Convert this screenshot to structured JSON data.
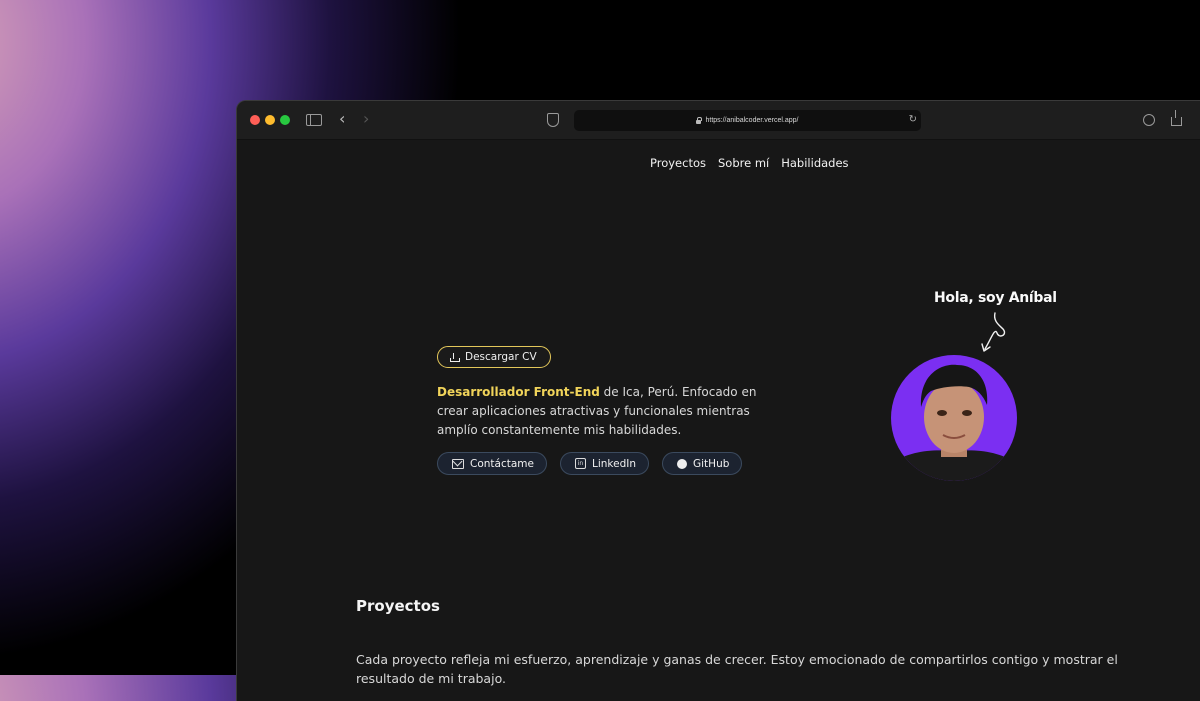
{
  "browser": {
    "url": "https://anibalcoder.vercel.app/"
  },
  "nav": {
    "items": [
      "Proyectos",
      "Sobre mí",
      "Habilidades"
    ]
  },
  "hero": {
    "cv_button": "Descargar CV",
    "role_highlight": "Desarrollador Front-End",
    "description": " de Ica, Perú. Enfocado en crear aplicaciones atractivas y funcionales mientras amplío constantemente mis habilidades.",
    "links": {
      "contact": "Contáctame",
      "linkedin": "LinkedIn",
      "github": "GitHub"
    },
    "greeting": "Hola, soy Aníbal"
  },
  "projects": {
    "title": "Proyectos",
    "description": "Cada proyecto refleja mi esfuerzo, aprendizaje y ganas de crecer. Estoy emocionado de compartirlos contigo y mostrar el resultado de mi trabajo."
  },
  "colors": {
    "accent_yellow": "#f1d45a",
    "avatar_bg": "#7b2ff2",
    "page_bg": "#171717"
  }
}
